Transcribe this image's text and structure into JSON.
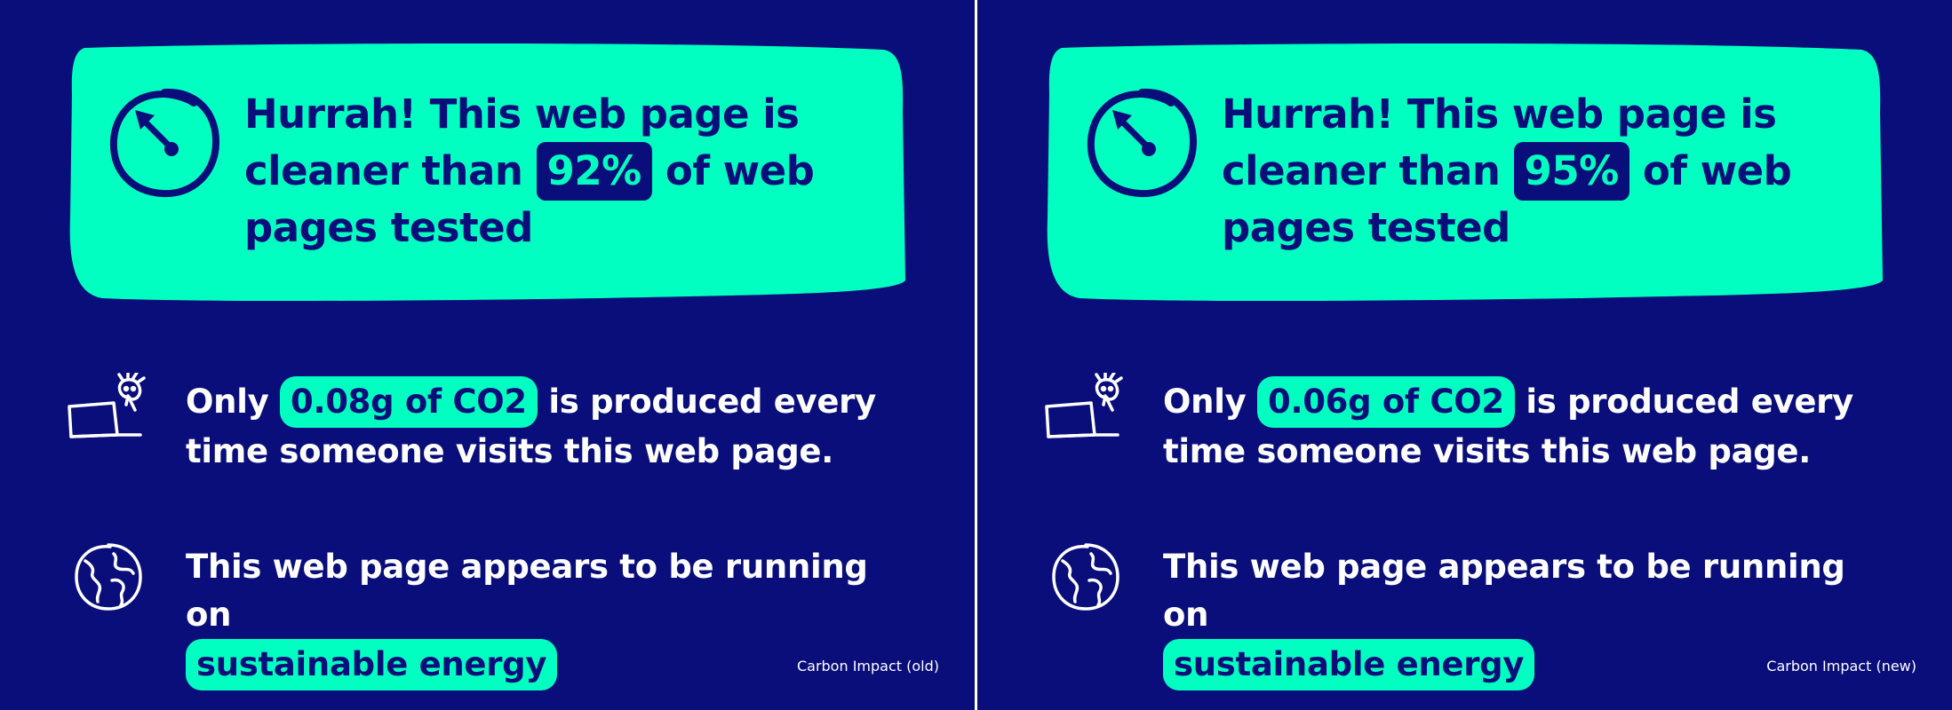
{
  "colors": {
    "background": "#0a0e7a",
    "accent": "#00ffc0",
    "text": "#ffffff"
  },
  "panels": [
    {
      "hero": {
        "line1": "Hurrah! This web page is",
        "line2_pre": "cleaner than",
        "percent": "92%",
        "line2_post": "of web",
        "line3": "pages tested"
      },
      "co2": {
        "pre": "Only",
        "amount": "0.08g of CO2",
        "post": "is produced every",
        "line2": "time someone visits this web page."
      },
      "energy": {
        "line1": "This web page appears to be running on",
        "highlight": "sustainable energy"
      },
      "caption": "Carbon Impact (old)",
      "icons": [
        "clock-icon",
        "laptop-person-icon",
        "globe-icon"
      ]
    },
    {
      "hero": {
        "line1": "Hurrah! This web page is",
        "line2_pre": "cleaner than",
        "percent": "95%",
        "line2_post": "of web",
        "line3": "pages tested"
      },
      "co2": {
        "pre": "Only",
        "amount": "0.06g of CO2",
        "post": "is produced every",
        "line2": "time someone visits this web page."
      },
      "energy": {
        "line1": "This web page appears to be running on",
        "highlight": "sustainable energy"
      },
      "caption": "Carbon Impact (new)",
      "icons": [
        "clock-icon",
        "laptop-person-icon",
        "globe-icon"
      ]
    }
  ]
}
